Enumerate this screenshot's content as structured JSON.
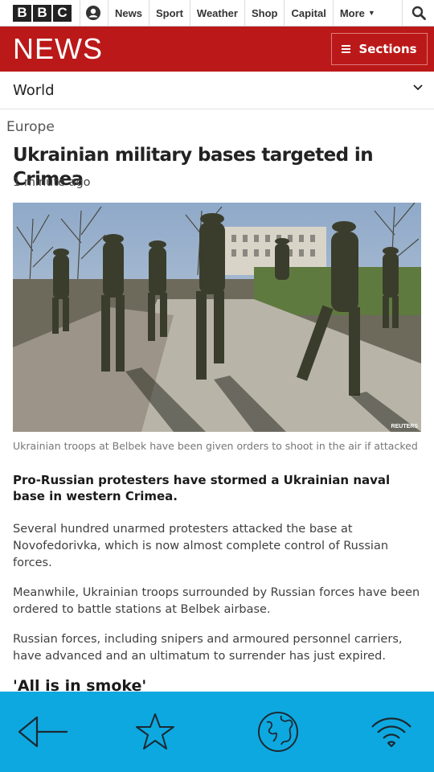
{
  "topbar": {
    "logo_letters": [
      "B",
      "B",
      "C"
    ],
    "nav": [
      "News",
      "Sport",
      "Weather",
      "Shop",
      "Capital"
    ],
    "more_label": "More",
    "icons": {
      "account": "account-icon",
      "search": "search-icon",
      "more": "caret-down-icon"
    }
  },
  "newsbar": {
    "wordmark": "NEWS",
    "sections_label": "Sections",
    "color": "#bb1919"
  },
  "section_nav": {
    "current": "World",
    "chevron": "chevron-down-icon"
  },
  "article": {
    "section": "Europe",
    "headline": "Ukrainian military bases targeted in Crimea",
    "timestamp": "1 minute ago",
    "image_credit": "REUTERS",
    "caption": "Ukrainian troops at Belbek have been given orders to shoot in the air if attacked",
    "intro": "Pro-Russian protesters have stormed a Ukrainian naval base in western Crimea.",
    "paragraphs": [
      "Several hundred unarmed protesters attacked the base at Novofedorivka, which is now almost complete control of Russian forces.",
      "Meanwhile, Ukrainian troops surrounded by Russian forces have been ordered to battle stations at Belbek airbase.",
      "Russian forces, including snipers and armoured personnel carriers, have advanced and an ultimatum to surrender has just expired."
    ],
    "subheading": "'All is in smoke'"
  },
  "bottom_bar": {
    "color": "#0ea8e0",
    "icons": [
      "back-arrow-icon",
      "star-icon",
      "globe-icon",
      "wifi-icon"
    ]
  }
}
